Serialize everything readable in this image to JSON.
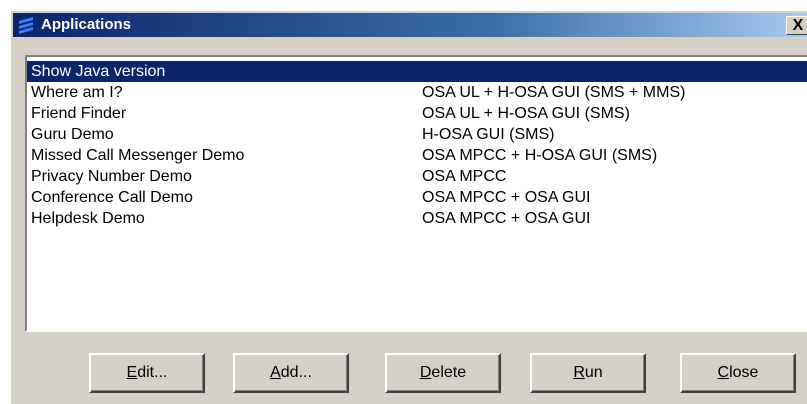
{
  "window": {
    "title": "Applications",
    "close_glyph": "X"
  },
  "colors": {
    "titlebar_start": "#0a246a",
    "titlebar_end": "#a6caf0",
    "selection": "#0a246a",
    "face": "#d4d0c8"
  },
  "icons": {
    "app_logo": "stacked-stripes-logo-icon",
    "close": "close-icon"
  },
  "list": {
    "selected_index": 0,
    "rows": [
      {
        "name": "Show Java version",
        "desc": ""
      },
      {
        "name": "Where am I?",
        "desc": "OSA UL + H-OSA GUI (SMS + MMS)"
      },
      {
        "name": "Friend Finder",
        "desc": "OSA UL + H-OSA GUI (SMS)"
      },
      {
        "name": "Guru Demo",
        "desc": "H-OSA GUI (SMS)"
      },
      {
        "name": "Missed Call Messenger Demo",
        "desc": "OSA MPCC + H-OSA GUI (SMS)"
      },
      {
        "name": "Privacy Number Demo",
        "desc": "OSA MPCC"
      },
      {
        "name": "Conference Call Demo",
        "desc": "OSA MPCC + OSA GUI"
      },
      {
        "name": "Helpdesk Demo",
        "desc": "OSA MPCC + OSA GUI"
      }
    ]
  },
  "buttons": {
    "edit": {
      "mnemonic": "E",
      "rest": "dit..."
    },
    "add": {
      "mnemonic": "A",
      "rest": "dd..."
    },
    "delete": {
      "mnemonic": "D",
      "rest": "elete"
    },
    "run": {
      "mnemonic": "R",
      "rest": "un"
    },
    "close": {
      "mnemonic": "C",
      "rest": "lose"
    }
  }
}
